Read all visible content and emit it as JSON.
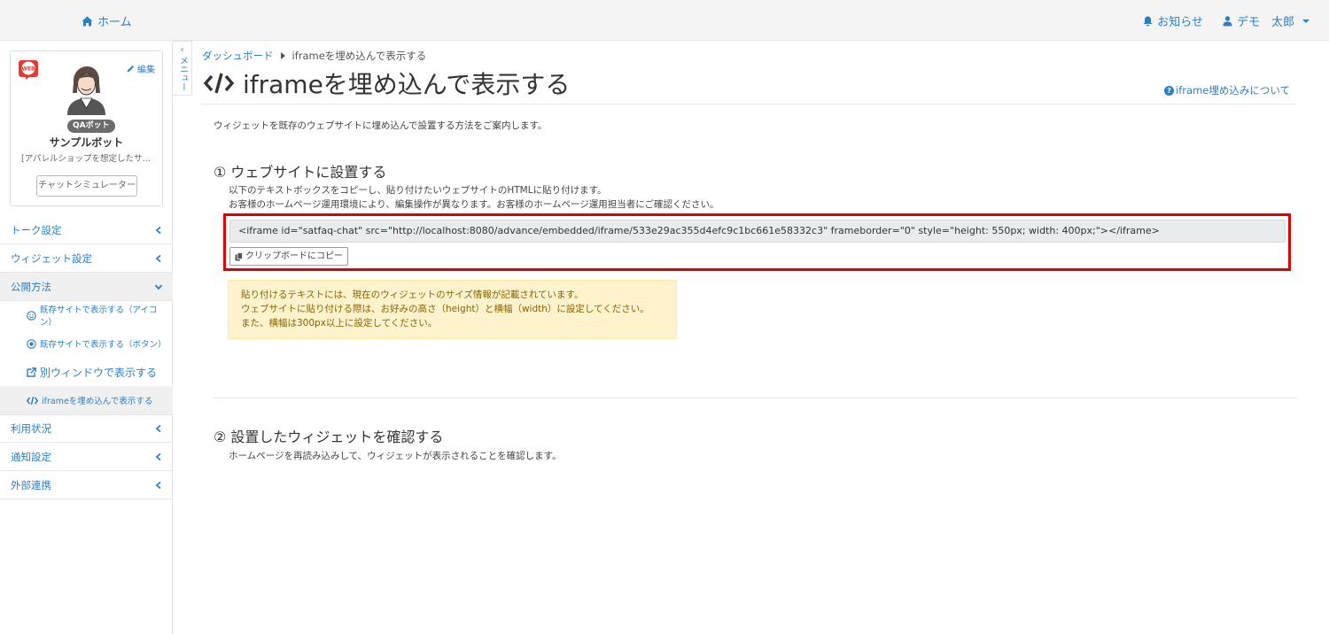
{
  "topbar": {
    "home": "ホーム",
    "notifications": "お知らせ",
    "user": "デモ　太郎"
  },
  "sidebar": {
    "badge_label": "WEB",
    "edit_label": "編集",
    "qa_badge": "QAボット",
    "bot_name": "サンプルボット",
    "bot_desc": "[アパレルショップを想定したサンプルボット]",
    "simulator_button": "チャットシミュレーター",
    "menu_tab_label": "メニュー",
    "menu": {
      "talk": "トーク設定",
      "widget": "ウィジェット設定",
      "publish": "公開方法",
      "sub_icon": "既存サイトで表示する（アイコン）",
      "sub_button": "既存サイトで表示する（ボタン）",
      "sub_window": "別ウィンドウで表示する",
      "sub_iframe": "iframeを埋め込んで表示する",
      "usage": "利用状況",
      "notify": "通知設定",
      "external": "外部連携"
    }
  },
  "main": {
    "breadcrumb_root": "ダッシュボード",
    "breadcrumb_current": "iframeを埋め込んで表示する",
    "title": "iframeを埋め込んで表示する",
    "help_link": "iframe埋め込みについて",
    "intro": "ウィジェットを既存のウェブサイトに埋め込んで設置する方法をご案内します。",
    "step1": {
      "title": "① ウェブサイトに設置する",
      "desc1": "以下のテキストボックスをコピーし、貼り付けたいウェブサイトのHTMLに貼り付けます。",
      "desc2": "お客様のホームページ運用環境により、編集操作が異なります。お客様のホームページ運用担当者にご確認ください。",
      "code": "<iframe id=\"satfaq-chat\" src=\"http://localhost:8080/advance/embedded/iframe/533e29ac355d4efc9c1bc661e58332c3\" frameborder=\"0\" style=\"height: 550px; width: 400px;\"></iframe>",
      "copy_button": "クリップボードにコピー"
    },
    "alert": {
      "line1": "貼り付けるテキストには、現在のウィジェットのサイズ情報が記載されています。",
      "line2": "ウェブサイトに貼り付ける際は、お好みの高さ（height）と横幅（width）に設定してください。",
      "line3": "また、横幅は300px以上に設定してください。"
    },
    "step2": {
      "title": "② 設置したウィジェットを確認する",
      "desc": "ホームページを再読み込みして、ウィジェットが表示されることを確認します。"
    }
  },
  "colors": {
    "link": "#2d7fc1",
    "highlight_border": "#e00000",
    "alert_bg": "#fff3cd",
    "alert_text": "#856404"
  }
}
